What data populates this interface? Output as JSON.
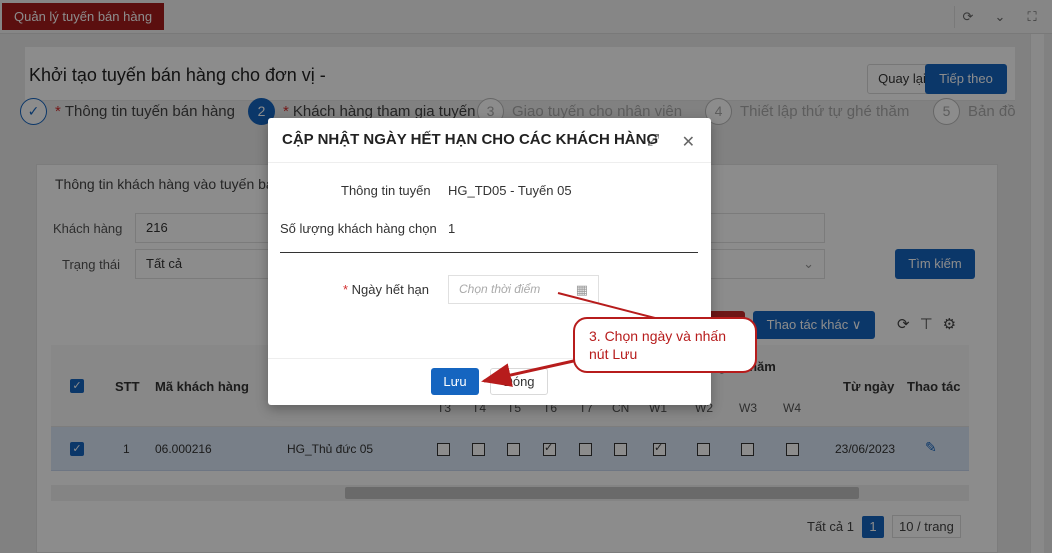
{
  "topbar": {
    "tab_label": "Quản lý tuyến bán hàng"
  },
  "header": {
    "title": "Khởi tạo tuyến bán hàng cho đơn vị -",
    "back_label": "Quay lại",
    "next_label": "Tiếp theo"
  },
  "steps": [
    {
      "num": "",
      "label": "Thông tin tuyến bán hàng",
      "required": "*"
    },
    {
      "num": "2",
      "label": "Khách hàng tham gia tuyến",
      "required": "*"
    },
    {
      "num": "3",
      "label": "Giao tuyến cho nhân viên"
    },
    {
      "num": "4",
      "label": "Thiết lập thứ tự ghé thăm"
    },
    {
      "num": "5",
      "label": "Bản đồ"
    }
  ],
  "section": {
    "title": "Thông tin khách hàng vào tuyến bán hàng"
  },
  "filters": {
    "customer_label": "Khách hàng",
    "customer_value": "216",
    "status_label": "Trạng thái",
    "status_value": "Tất cả",
    "search_label": "Tìm kiếm"
  },
  "actions": {
    "more_label": "Thao tác khác ∨"
  },
  "table": {
    "headers": {
      "stt": "STT",
      "code": "Mã khách hàng",
      "visit": "Tần suất ghé thăm",
      "from": "Từ ngày",
      "action": "Thao tác"
    },
    "days": [
      "T3",
      "T4",
      "T5",
      "T6",
      "T7",
      "CN",
      "W1",
      "W2",
      "W3",
      "W4"
    ],
    "row": {
      "stt": "1",
      "code": "06.000216",
      "route": "HG_Thủ đức 05",
      "from": "23/06/2023"
    }
  },
  "pager": {
    "total": "Tất cả 1",
    "page": "1",
    "size": "10 / trang"
  },
  "modal": {
    "title": "CẬP NHẬT NGÀY HẾT HẠN CHO CÁC KHÁCH HÀNG",
    "route_label": "Thông tin tuyến",
    "route_value": "HG_TD05 - Tuyến 05",
    "count_label": "Số lượng khách hàng chọn",
    "count_value": "1",
    "expiry_label": "Ngày hết hạn",
    "expiry_placeholder": "Chọn thời điểm",
    "save_label": "Lưu",
    "close_label": "Đóng"
  },
  "callout": {
    "text": "3. Chọn ngày và nhấn nút Lưu"
  },
  "colors": {
    "primary": "#1565c0",
    "brand_red": "#a61d1d",
    "callout": "#b71c1c"
  }
}
